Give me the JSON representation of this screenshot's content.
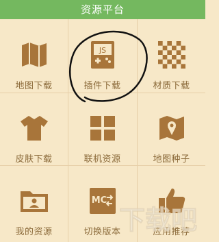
{
  "header": {
    "title": "资源平台"
  },
  "colors": {
    "header_bg": "#74b85f",
    "background": "#f7e8c8",
    "icon": "#a8753a",
    "label": "#8b6a3a",
    "grid_line": "#e6cfa8"
  },
  "tiles": [
    {
      "label": "地图下载",
      "icon": "map-icon"
    },
    {
      "label": "插件下载",
      "icon": "plugin-js-icon"
    },
    {
      "label": "材质下载",
      "icon": "texture-checker-icon"
    },
    {
      "label": "皮肤下载",
      "icon": "shirt-icon"
    },
    {
      "label": "联机资源",
      "icon": "grid-four-icon"
    },
    {
      "label": "地图种子",
      "icon": "map-pin-icon"
    },
    {
      "label": "我的资源",
      "icon": "folder-user-icon"
    },
    {
      "label": "切换版本",
      "icon": "mc-switch-icon"
    },
    {
      "label": "应用推荐",
      "icon": "thumbs-up-icon"
    }
  ],
  "plugin_icon_text": "JS",
  "mc_icon_text": "MC",
  "watermark": "下载吧"
}
